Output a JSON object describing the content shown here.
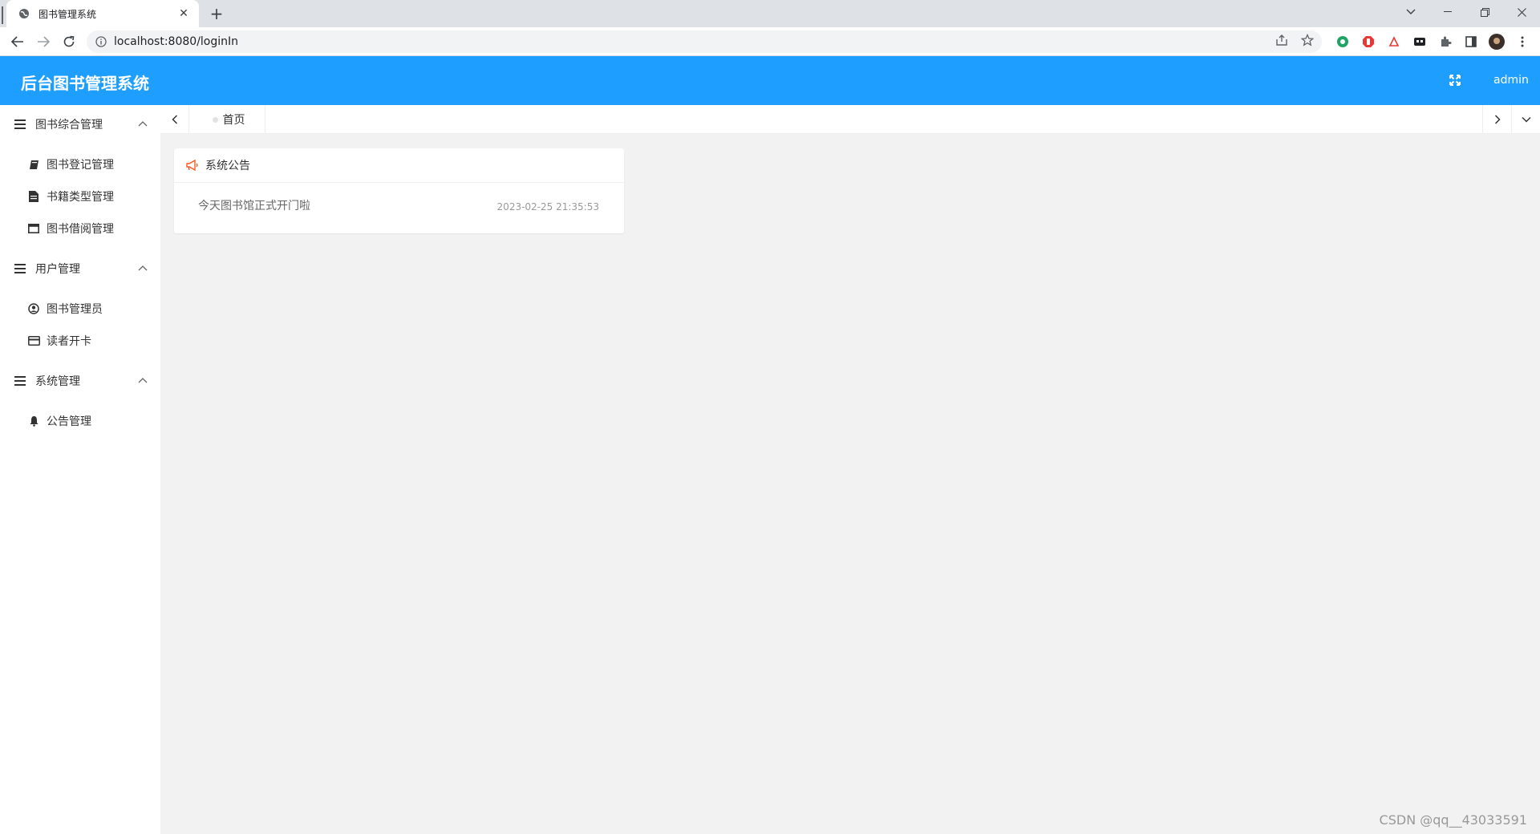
{
  "browser": {
    "tab_title": "图书管理系统",
    "url": "localhost:8080/loginIn"
  },
  "app": {
    "title": "后台图书管理系统",
    "username": "admin",
    "header_color": "#1e9fff"
  },
  "sidebar": {
    "groups": [
      {
        "label": "图书综合管理",
        "items": [
          {
            "label": "图书登记管理",
            "icon": "book-icon"
          },
          {
            "label": "书籍类型管理",
            "icon": "file-icon"
          },
          {
            "label": "图书借阅管理",
            "icon": "window-icon"
          }
        ]
      },
      {
        "label": "用户管理",
        "items": [
          {
            "label": "图书管理员",
            "icon": "user-circle-icon"
          },
          {
            "label": "读者开卡",
            "icon": "credit-card-icon"
          }
        ]
      },
      {
        "label": "系统管理",
        "items": [
          {
            "label": "公告管理",
            "icon": "bell-icon"
          }
        ]
      }
    ]
  },
  "page_tabs": {
    "home_label": "首页"
  },
  "notice": {
    "title": "系统公告",
    "items": [
      {
        "text": "今天图书馆正式开门啦",
        "time": "2023-02-25 21:35:53"
      }
    ]
  },
  "watermark": "CSDN @qq__43033591"
}
